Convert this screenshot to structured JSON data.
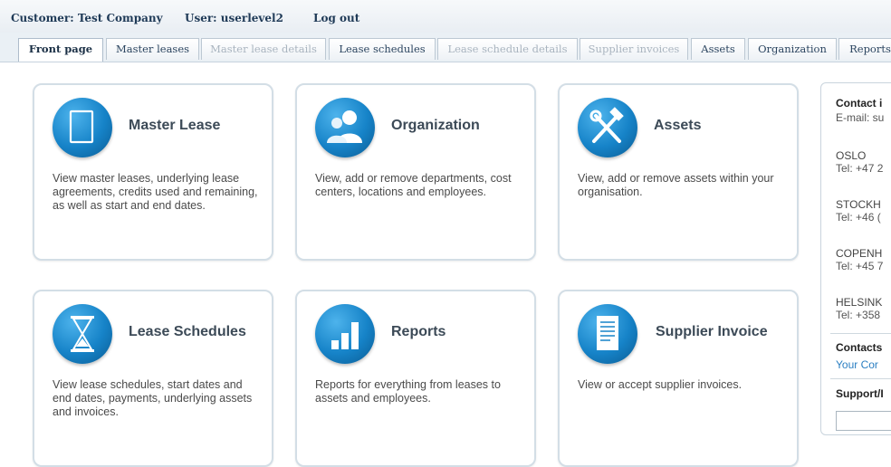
{
  "header": {
    "customer": "Customer: Test Company",
    "user": "User: userlevel2",
    "logout": "Log out"
  },
  "tabs": [
    {
      "label": "Front page",
      "state": "active"
    },
    {
      "label": "Master leases",
      "state": "enabled"
    },
    {
      "label": "Master lease details",
      "state": "disabled"
    },
    {
      "label": "Lease schedules",
      "state": "enabled"
    },
    {
      "label": "Lease schedule details",
      "state": "disabled"
    },
    {
      "label": "Supplier invoices",
      "state": "disabled"
    },
    {
      "label": "Assets",
      "state": "enabled"
    },
    {
      "label": "Organization",
      "state": "enabled"
    },
    {
      "label": "Reports",
      "state": "enabled"
    }
  ],
  "cards": [
    {
      "title": "Master Lease",
      "icon": "document-icon",
      "description": "View master leases, underlying lease agreements, credits used and remaining, as well as start and end dates."
    },
    {
      "title": "Organization",
      "icon": "people-icon",
      "description": "View, add or remove departments, cost centers, locations and employees."
    },
    {
      "title": "Assets",
      "icon": "tools-icon",
      "description": "View, add or remove assets within your organisation."
    },
    {
      "title": "Lease Schedules",
      "icon": "hourglass-icon",
      "description": "View lease schedules, start dates and end dates, payments, underlying assets and invoices."
    },
    {
      "title": "Reports",
      "icon": "bar-chart-icon",
      "description": "Reports for everything from leases to assets and employees."
    },
    {
      "title": "Supplier Invoice",
      "icon": "invoice-icon",
      "description": "View or accept supplier invoices."
    }
  ],
  "contact": {
    "heading": "Contact i",
    "email": "E-mail: su",
    "offices": [
      {
        "city": "OSLO",
        "tel": "Tel: +47 2"
      },
      {
        "city": "STOCKH",
        "tel": "Tel: +46 ("
      },
      {
        "city": "COPENH",
        "tel": "Tel: +45 7"
      },
      {
        "city": "HELSINK",
        "tel": "Tel: +358"
      }
    ],
    "contacts_heading": "Contacts",
    "contacts_link": "Your Cor",
    "support_heading": "Support/I"
  },
  "colors": {
    "accent": "#1683c8",
    "link": "#2b7fc2",
    "header_text": "#1f3a57"
  }
}
